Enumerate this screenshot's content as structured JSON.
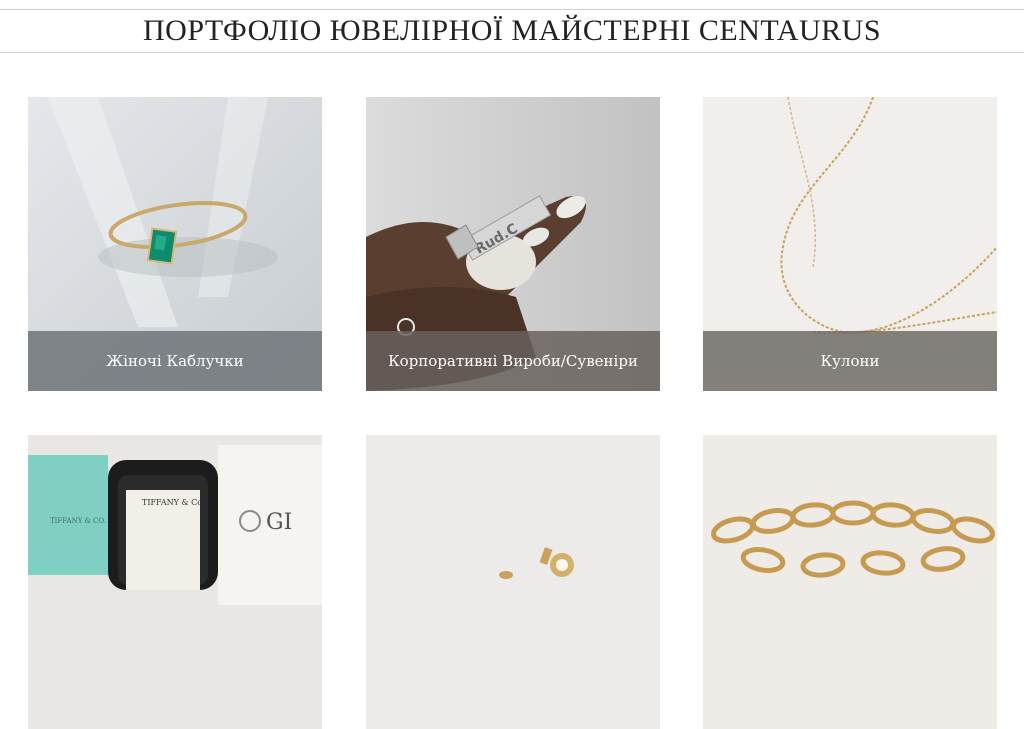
{
  "header": {
    "title": "ПОРТФОЛІО ЮВЕЛІРНОЇ МАЙСТЕРНІ CENTAURUS"
  },
  "portfolio": {
    "cards": [
      {
        "label": "Жіночі Каблучки",
        "image_icon": "emerald-ring-photo",
        "caption_color": "#7f858a"
      },
      {
        "label": "Корпоративні Вироби/Сувеніри",
        "image_icon": "corporate-pendant-photo",
        "caption_color": "#7a7470"
      },
      {
        "label": "Кулони",
        "image_icon": "gold-chain-pendant-photo",
        "caption_color": "#7f7b76"
      },
      {
        "label": "",
        "image_icon": "tiffany-ring-box-photo",
        "caption_color": ""
      },
      {
        "label": "",
        "image_icon": "gold-earrings-photo",
        "caption_color": ""
      },
      {
        "label": "",
        "image_icon": "gold-link-chain-photo",
        "caption_color": ""
      }
    ],
    "photo_text": {
      "tiffany_box": "TIFFANY & CO.",
      "tiffany_pouch": "TIFFANY & Co.",
      "certificate": "GI",
      "pendant_engraving": "Rud.C"
    }
  }
}
